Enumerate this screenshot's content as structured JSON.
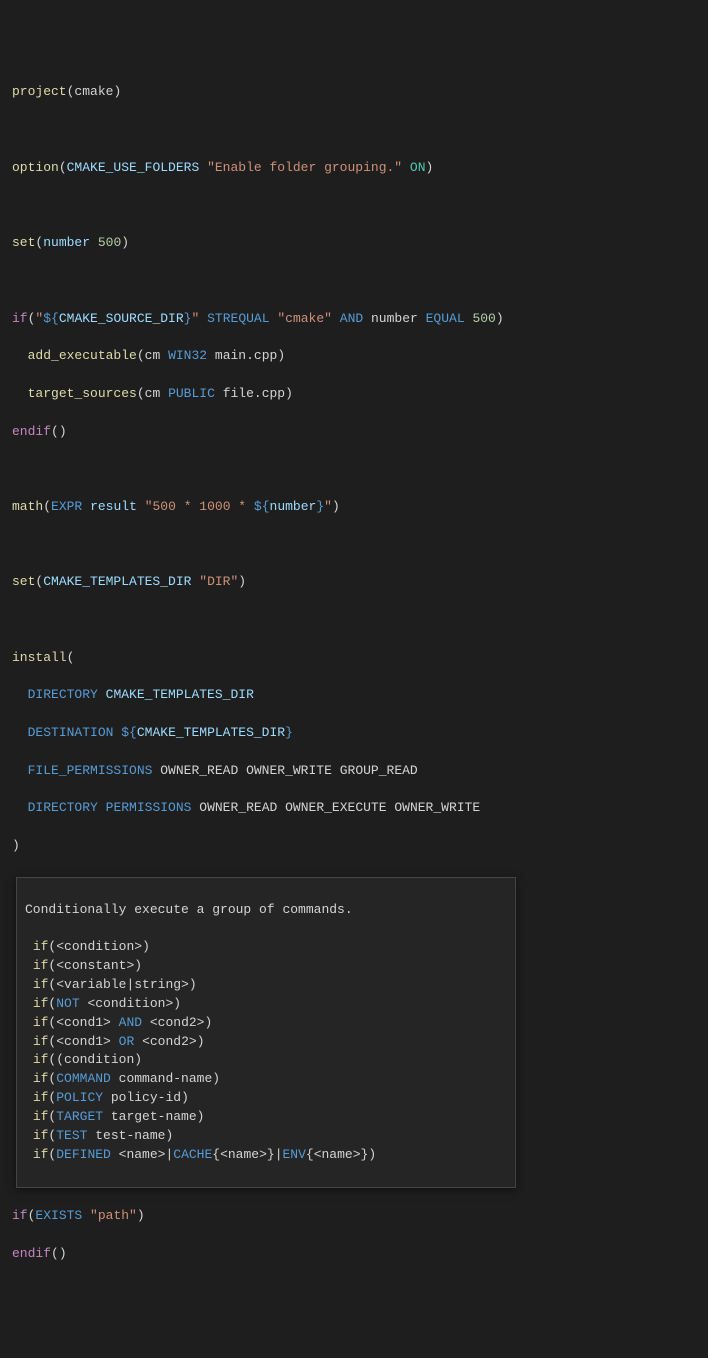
{
  "code": {
    "l1_fn": "project",
    "l1_arg": "cmake",
    "l2_fn": "option",
    "l2_var": "CMAKE_USE_FOLDERS",
    "l2_str": "\"Enable folder grouping.\"",
    "l2_on": "ON",
    "l3_fn": "set",
    "l3_var": "number",
    "l3_num": "500",
    "l4_fn": "if",
    "l4_strA": "\"",
    "l4_interp_open": "${",
    "l4_interp_var": "CMAKE_SOURCE_DIR",
    "l4_interp_close": "}",
    "l4_strB": "\"",
    "l4_kw1": "STREQUAL",
    "l4_str2": "\"cmake\"",
    "l4_kw2": "AND",
    "l4_var2": "number",
    "l4_kw3": "EQUAL",
    "l4_num2": "500",
    "l5_fn": "add_executable",
    "l5_arg1": "cm",
    "l5_kw": "WIN32",
    "l5_arg2": "main.cpp",
    "l6_fn": "target_sources",
    "l6_arg1": "cm",
    "l6_kw": "PUBLIC",
    "l6_arg2": "file.cpp",
    "l7_fn": "endif",
    "l8_fn": "math",
    "l8_kw": "EXPR",
    "l8_var": "result",
    "l8_strA": "\"500 * 1000 * ",
    "l8_interp_open": "${",
    "l8_interp_var": "number",
    "l8_interp_close": "}",
    "l8_strB": "\"",
    "l9_fn": "set",
    "l9_var": "CMAKE_TEMPLATES_DIR",
    "l9_str": "\"DIR\"",
    "l10_fn": "install",
    "l11_kw": "DIRECTORY",
    "l11_var": "CMAKE_TEMPLATES_DIR",
    "l12_kw": "DESTINATION",
    "l12_interp_open": "${",
    "l12_interp_var": "CMAKE_TEMPLATES_DIR",
    "l12_interp_close": "}",
    "l13_kw": "FILE_PERMISSIONS",
    "l13_p1": "OWNER_READ",
    "l13_p2": "OWNER_WRITE",
    "l13_p3": "GROUP_READ",
    "l14_kw1": "DIRECTORY",
    "l14_kw2": "PERMISSIONS",
    "l14_p1": "OWNER_READ",
    "l14_p2": "OWNER_EXECUTE",
    "l14_p3": "OWNER_WRITE",
    "l15_paren": ")",
    "l16_fn": "if",
    "l16_kw": "EXISTS",
    "l16_str": "\"path\"",
    "l17_fn": "endif"
  },
  "tooltip": {
    "title": "Conditionally execute a group of commands.",
    "rows": [
      {
        "fn": "if",
        "open": "(",
        "parts": [
          {
            "t": "<condition>",
            "c": "txt"
          }
        ],
        "close": ")"
      },
      {
        "fn": "if",
        "open": "(",
        "parts": [
          {
            "t": "<constant>",
            "c": "txt"
          }
        ],
        "close": ")"
      },
      {
        "fn": "if",
        "open": "(",
        "parts": [
          {
            "t": "<variable|string>",
            "c": "txt"
          }
        ],
        "close": ")"
      },
      {
        "fn": "if",
        "open": "(",
        "parts": [
          {
            "t": "NOT",
            "c": "kw"
          },
          {
            "t": " <condition>",
            "c": "txt"
          }
        ],
        "close": ")"
      },
      {
        "fn": "if",
        "open": "(",
        "parts": [
          {
            "t": "<cond1> ",
            "c": "txt"
          },
          {
            "t": "AND",
            "c": "kw"
          },
          {
            "t": " <cond2>",
            "c": "txt"
          }
        ],
        "close": ")"
      },
      {
        "fn": "if",
        "open": "(",
        "parts": [
          {
            "t": "<cond1> ",
            "c": "txt"
          },
          {
            "t": "OR",
            "c": "kw"
          },
          {
            "t": " <cond2>",
            "c": "txt"
          }
        ],
        "close": ")"
      },
      {
        "fn": "if",
        "open": "((",
        "parts": [
          {
            "t": "condition",
            "c": "txt"
          }
        ],
        "close": ")"
      },
      {
        "fn": "if",
        "open": "(",
        "parts": [
          {
            "t": "COMMAND",
            "c": "kw"
          },
          {
            "t": " command-name",
            "c": "txt"
          }
        ],
        "close": ")"
      },
      {
        "fn": "if",
        "open": "(",
        "parts": [
          {
            "t": "POLICY",
            "c": "kw"
          },
          {
            "t": " policy-id",
            "c": "txt"
          }
        ],
        "close": ")"
      },
      {
        "fn": "if",
        "open": "(",
        "parts": [
          {
            "t": "TARGET",
            "c": "kw"
          },
          {
            "t": " target-name",
            "c": "txt"
          }
        ],
        "close": ")"
      },
      {
        "fn": "if",
        "open": "(",
        "parts": [
          {
            "t": "TEST",
            "c": "kw"
          },
          {
            "t": " test-name",
            "c": "txt"
          }
        ],
        "close": ")"
      },
      {
        "fn": "if",
        "open": "(",
        "parts": [
          {
            "t": "DEFINED",
            "c": "kw"
          },
          {
            "t": " <name>|",
            "c": "txt"
          },
          {
            "t": "CACHE",
            "c": "kw"
          },
          {
            "t": "{<name>}|",
            "c": "txt"
          },
          {
            "t": "ENV",
            "c": "kw"
          },
          {
            "t": "{<name>}",
            "c": "txt"
          }
        ],
        "close": ")"
      }
    ]
  }
}
